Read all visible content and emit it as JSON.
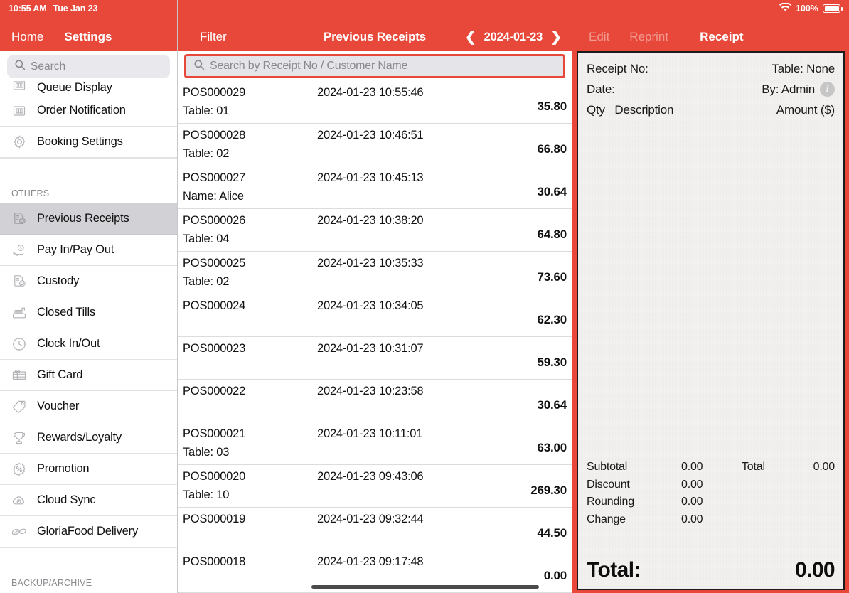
{
  "status_bar": {
    "time": "10:55 AM",
    "date": "Tue Jan 23",
    "battery_percent": "100%",
    "wifi_icon": "wifi-icon",
    "battery_icon": "battery-icon"
  },
  "sidebar": {
    "nav": {
      "home_label": "Home",
      "settings_label": "Settings"
    },
    "search": {
      "placeholder": "Search",
      "value": "",
      "icon": "search-icon"
    },
    "items": [
      {
        "label": "Queue Display",
        "icon": "queue-display-icon",
        "selected": false,
        "clipped": true
      },
      {
        "label": "Order Notification",
        "icon": "order-notification-icon",
        "selected": false
      },
      {
        "label": "Booking Settings",
        "icon": "gear-icon",
        "selected": false
      }
    ],
    "group_others": "OTHERS",
    "items_others": [
      {
        "label": "Previous Receipts",
        "icon": "receipt-document-icon",
        "selected": true
      },
      {
        "label": "Pay In/Pay Out",
        "icon": "cash-hand-icon",
        "selected": false
      },
      {
        "label": "Custody",
        "icon": "custody-document-icon",
        "selected": false
      },
      {
        "label": "Closed Tills",
        "icon": "cash-register-icon",
        "selected": false
      },
      {
        "label": "Clock In/Out",
        "icon": "clock-icon",
        "selected": false
      },
      {
        "label": "Gift Card",
        "icon": "gift-card-icon",
        "selected": false
      },
      {
        "label": "Voucher",
        "icon": "tag-icon",
        "selected": false
      },
      {
        "label": "Rewards/Loyalty",
        "icon": "trophy-icon",
        "selected": false
      },
      {
        "label": "Promotion",
        "icon": "percent-badge-icon",
        "selected": false
      },
      {
        "label": "Cloud Sync",
        "icon": "cloud-sync-icon",
        "selected": false
      },
      {
        "label": "GloriaFood Delivery",
        "icon": "leaf-icon",
        "selected": false
      }
    ],
    "group_backup": "BACKUP/ARCHIVE"
  },
  "center": {
    "filter_label": "Filter",
    "title": "Previous Receipts",
    "date_prev_icon": "chevron-left-icon",
    "date_next_icon": "chevron-right-icon",
    "date_value": "2024-01-23",
    "search": {
      "placeholder": "Search by Receipt No / Customer Name",
      "value": "",
      "icon": "search-icon",
      "highlight_color": "#E8483A"
    },
    "receipts": [
      {
        "no": "POS000029",
        "datetime": "2024-01-23 10:55:46",
        "sub": "Table: 01",
        "amount": "35.80"
      },
      {
        "no": "POS000028",
        "datetime": "2024-01-23 10:46:51",
        "sub": "Table: 02",
        "amount": "66.80"
      },
      {
        "no": "POS000027",
        "datetime": "2024-01-23 10:45:13",
        "sub": "Name: Alice",
        "amount": "30.64"
      },
      {
        "no": "POS000026",
        "datetime": "2024-01-23 10:38:20",
        "sub": "Table: 04",
        "amount": "64.80"
      },
      {
        "no": "POS000025",
        "datetime": "2024-01-23 10:35:33",
        "sub": "Table: 02",
        "amount": "73.60"
      },
      {
        "no": "POS000024",
        "datetime": "2024-01-23 10:34:05",
        "sub": "",
        "amount": "62.30"
      },
      {
        "no": "POS000023",
        "datetime": "2024-01-23 10:31:07",
        "sub": "",
        "amount": "59.30"
      },
      {
        "no": "POS000022",
        "datetime": "2024-01-23 10:23:58",
        "sub": "",
        "amount": "30.64"
      },
      {
        "no": "POS000021",
        "datetime": "2024-01-23 10:11:01",
        "sub": "Table: 03",
        "amount": "63.00"
      },
      {
        "no": "POS000020",
        "datetime": "2024-01-23 09:43:06",
        "sub": "Table: 10",
        "amount": "269.30"
      },
      {
        "no": "POS000019",
        "datetime": "2024-01-23 09:32:44",
        "sub": "",
        "amount": "44.50"
      },
      {
        "no": "POS000018",
        "datetime": "2024-01-23 09:17:48",
        "sub": "",
        "amount": "0.00"
      }
    ]
  },
  "receipt_panel": {
    "edit_label": "Edit",
    "reprint_label": "Reprint",
    "receipt_label": "Receipt",
    "receipt_no_label": "Receipt No:",
    "receipt_no_value": "",
    "table_label": "Table: None",
    "date_label": "Date:",
    "date_value": "",
    "by_label": "By: Admin",
    "info_icon": "info-icon",
    "col_qty": "Qty",
    "col_description": "Description",
    "col_amount": "Amount ($)",
    "items": [],
    "totals": [
      {
        "key": "Subtotal",
        "value": "0.00"
      },
      {
        "key": "Discount",
        "value": "0.00"
      },
      {
        "key": "Rounding",
        "value": "0.00"
      },
      {
        "key": "Change",
        "value": "0.00"
      }
    ],
    "total_side_label": "Total",
    "total_side_value": "0.00",
    "grand_total_label": "Total:",
    "grand_total_value": "0.00"
  },
  "colors": {
    "brand_red": "#E8483A",
    "sidebar_selected": "#D1D1D6",
    "paper": "#F2F1EF",
    "search_field": "#E8E8ED"
  }
}
